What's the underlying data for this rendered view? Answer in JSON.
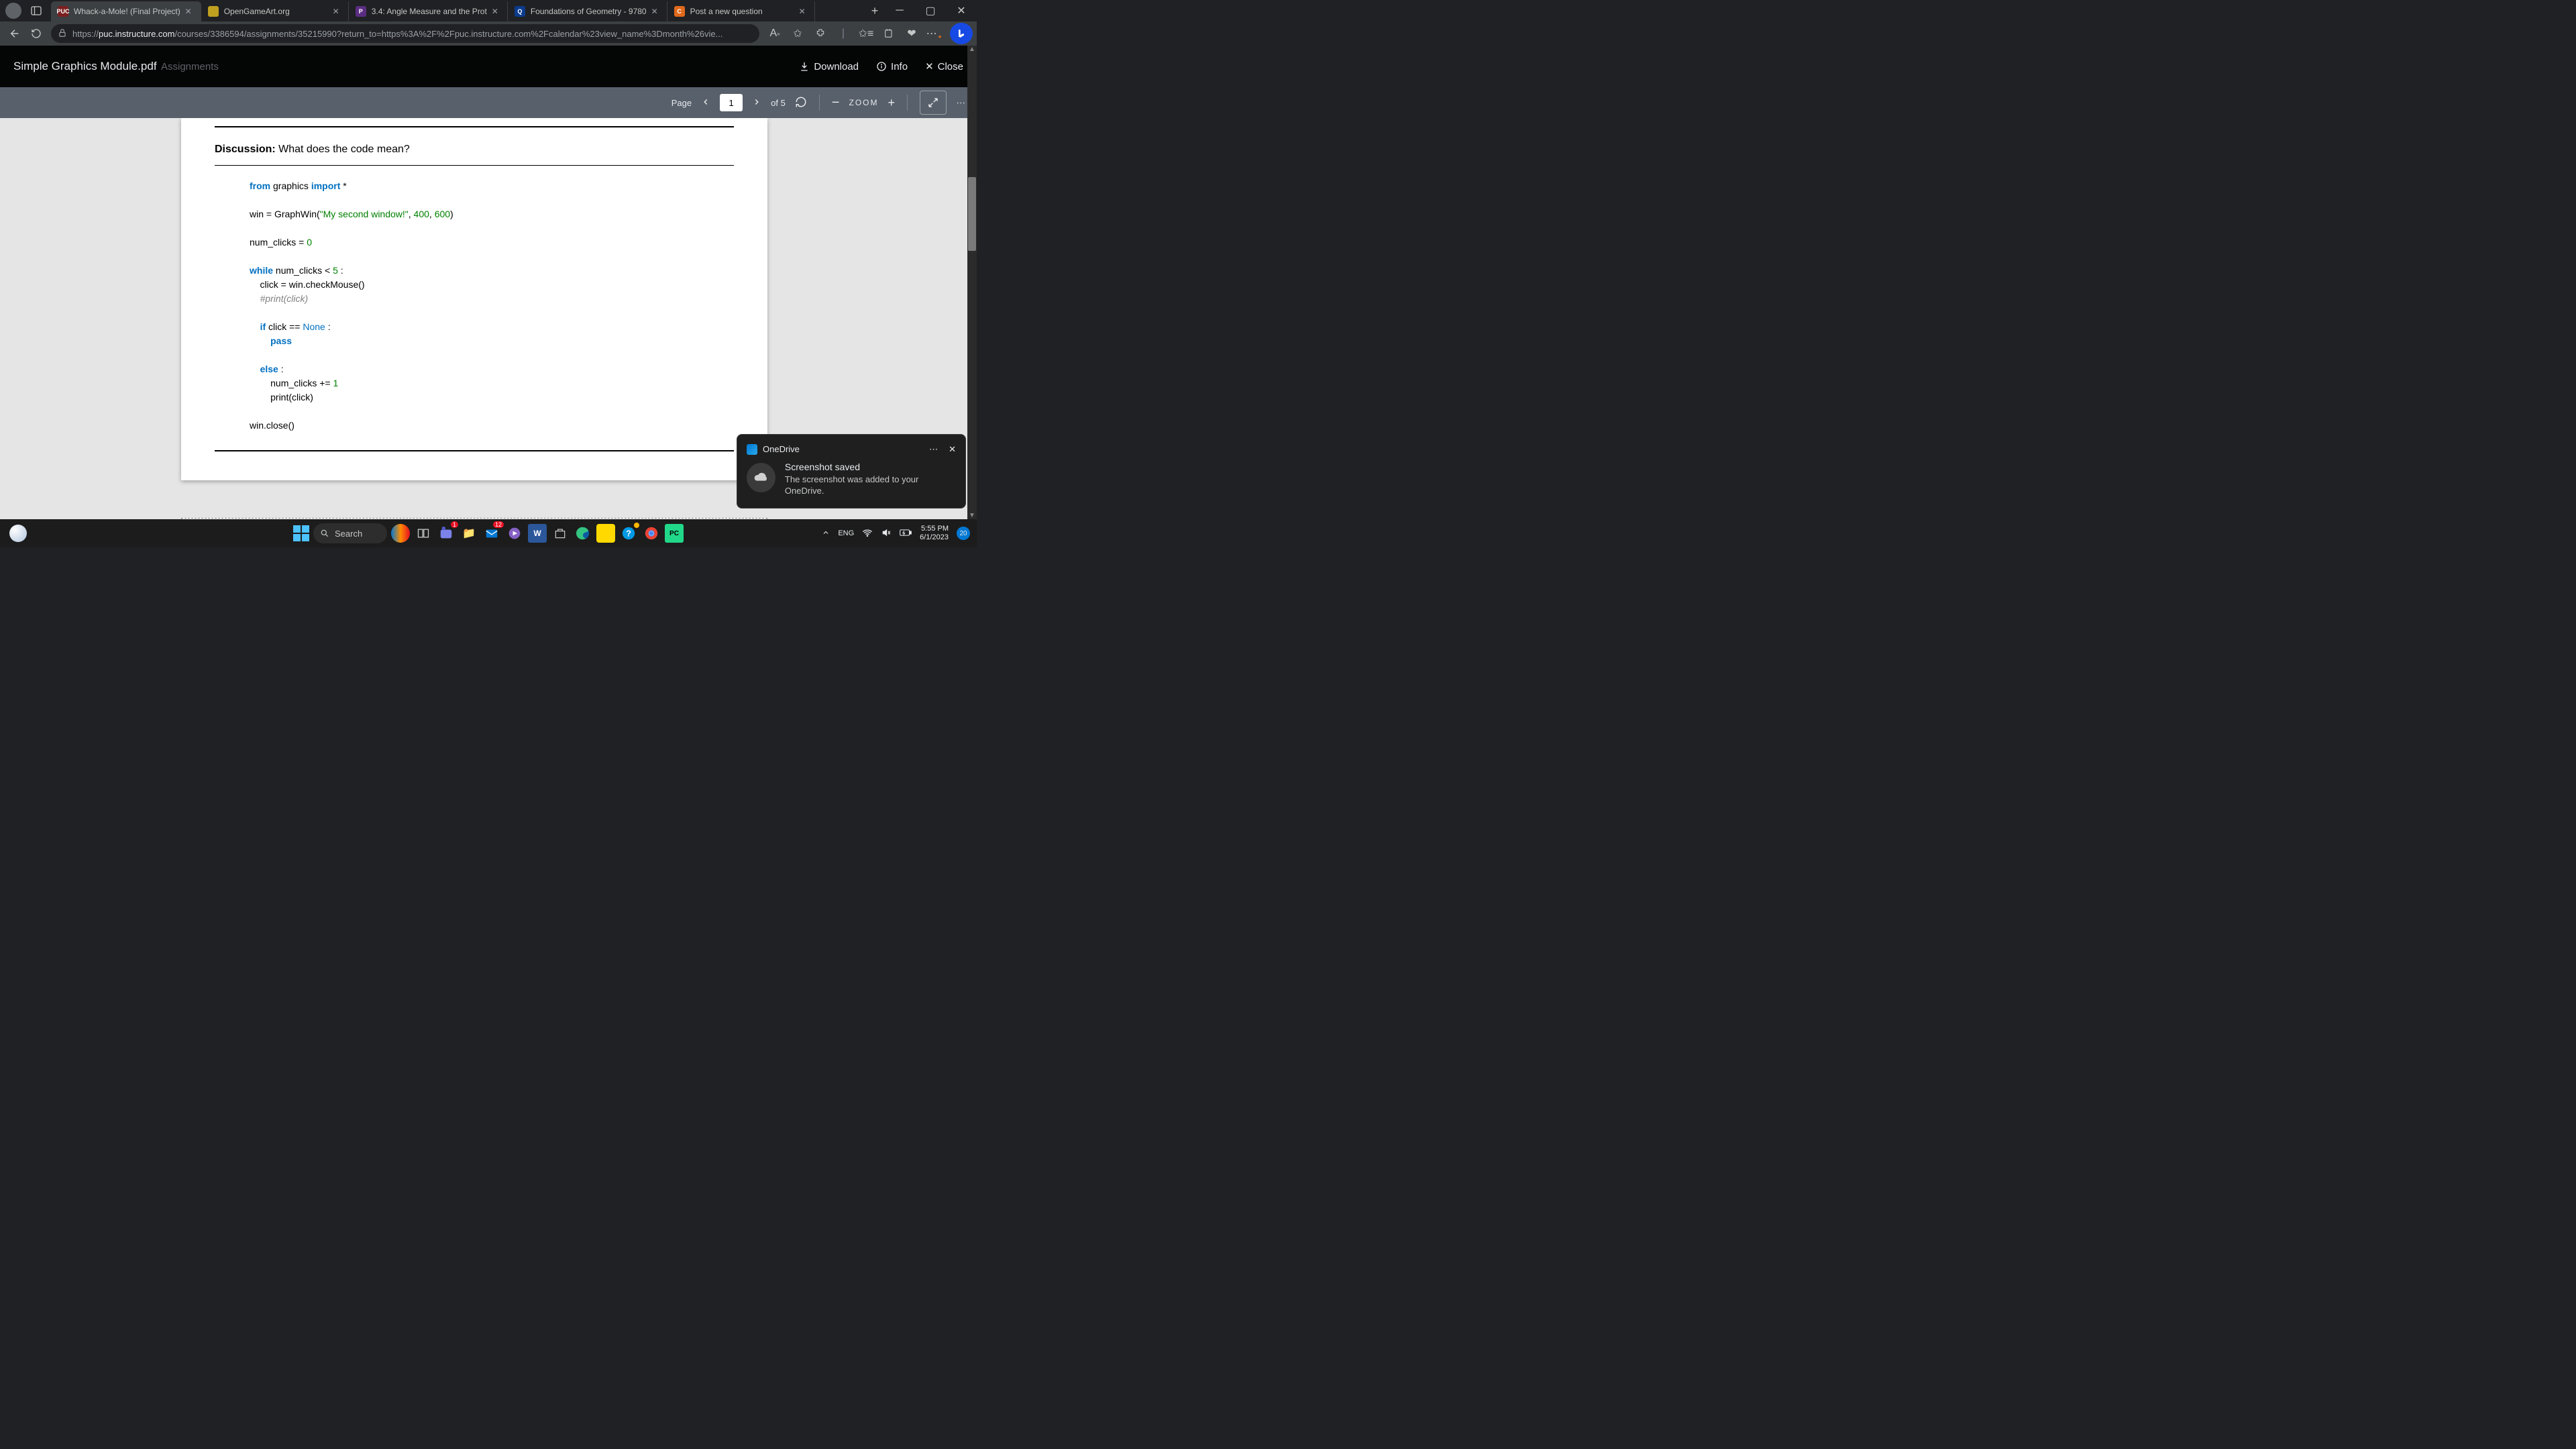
{
  "browser": {
    "tabs": [
      {
        "label": "Whack-a-Mole! (Final Project)",
        "icon_bg": "#7a1f1f",
        "icon_txt": "PUC",
        "active": true
      },
      {
        "label": "OpenGameArt.org",
        "icon_bg": "#c0a020",
        "icon_txt": "",
        "active": false
      },
      {
        "label": "3.4: Angle Measure and the Prot",
        "icon_bg": "#5a2d82",
        "icon_txt": "P",
        "active": false
      },
      {
        "label": "Foundations of Geometry - 9780",
        "icon_bg": "#0b3b8c",
        "icon_txt": "Q",
        "active": false
      },
      {
        "label": "Post a new question",
        "icon_bg": "#e06a1b",
        "icon_txt": "C",
        "active": false
      }
    ],
    "url_prefix": "https://",
    "url_host": "puc.instructure.com",
    "url_path": "/courses/3386594/assignments/35215990?return_to=https%3A%2F%2Fpuc.instructure.com%2Fcalendar%23view_name%3Dmonth%26vie..."
  },
  "pdf": {
    "title": "Simple Graphics Module.pdf",
    "ghost": "Assignments",
    "download": "Download",
    "info": "Info",
    "close": "Close",
    "page_label": "Page",
    "page_current": "1",
    "page_of": "of 5",
    "zoom_label": "ZOOM"
  },
  "doc": {
    "discussion_label": "Discussion:",
    "discussion_text": " What does the code mean?",
    "code_lines": [
      {
        "segs": [
          [
            "kw",
            "from"
          ],
          [
            "",
            " graphics "
          ],
          [
            "kw",
            "import"
          ],
          [
            "",
            " *"
          ]
        ]
      },
      {
        "segs": [
          [
            "",
            ""
          ]
        ]
      },
      {
        "segs": [
          [
            "",
            "win = GraphWin("
          ],
          [
            "str",
            "\"My second window!\""
          ],
          [
            "",
            ", "
          ],
          [
            "num",
            "400"
          ],
          [
            "",
            ", "
          ],
          [
            "num",
            "600"
          ],
          [
            "",
            ")"
          ]
        ]
      },
      {
        "segs": [
          [
            "",
            ""
          ]
        ]
      },
      {
        "segs": [
          [
            "",
            "num_clicks = "
          ],
          [
            "num",
            "0"
          ]
        ]
      },
      {
        "segs": [
          [
            "",
            ""
          ]
        ]
      },
      {
        "segs": [
          [
            "kw",
            "while"
          ],
          [
            "",
            " num_clicks < "
          ],
          [
            "num",
            "5"
          ],
          [
            "",
            " :"
          ]
        ]
      },
      {
        "segs": [
          [
            "",
            "    click = win.checkMouse()"
          ]
        ]
      },
      {
        "segs": [
          [
            "",
            "    "
          ],
          [
            "cmt",
            "#print(click)"
          ]
        ]
      },
      {
        "segs": [
          [
            "",
            ""
          ]
        ]
      },
      {
        "segs": [
          [
            "",
            "    "
          ],
          [
            "kw",
            "if"
          ],
          [
            "",
            " click == "
          ],
          [
            "bn",
            "None"
          ],
          [
            "",
            " :"
          ]
        ]
      },
      {
        "segs": [
          [
            "",
            "        "
          ],
          [
            "kw",
            "pass"
          ]
        ]
      },
      {
        "segs": [
          [
            "",
            ""
          ]
        ]
      },
      {
        "segs": [
          [
            "",
            "    "
          ],
          [
            "kw",
            "else"
          ],
          [
            "",
            " :"
          ]
        ]
      },
      {
        "segs": [
          [
            "",
            "        num_clicks += "
          ],
          [
            "num",
            "1"
          ]
        ]
      },
      {
        "segs": [
          [
            "",
            "        print(click)"
          ]
        ]
      },
      {
        "segs": [
          [
            "",
            ""
          ]
        ]
      },
      {
        "segs": [
          [
            "",
            "win.close()"
          ]
        ]
      }
    ]
  },
  "toast": {
    "app": "OneDrive",
    "title": "Screenshot saved",
    "body": "The screenshot was added to your OneDrive."
  },
  "taskbar": {
    "search": "Search",
    "lang": "ENG",
    "time": "5:55 PM",
    "date": "6/1/2023",
    "notif": "20",
    "mail_badge": "12",
    "teams_badge": "1"
  }
}
